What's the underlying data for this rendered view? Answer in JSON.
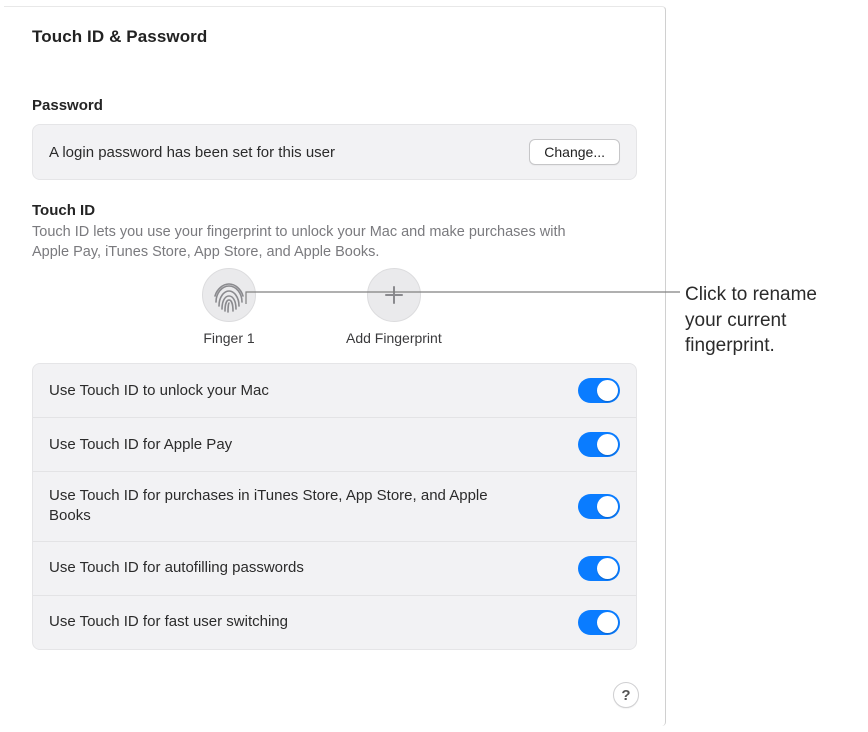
{
  "page_title": "Touch ID & Password",
  "password": {
    "heading": "Password",
    "status": "A login password has been set for this user",
    "change_label": "Change..."
  },
  "touchid": {
    "heading": "Touch ID",
    "description": "Touch ID lets you use your fingerprint to unlock your Mac and make purchases with Apple Pay, iTunes Store, App Store, and Apple Books.",
    "finger_label": "Finger 1",
    "add_label": "Add Fingerprint"
  },
  "options": [
    {
      "label": "Use Touch ID to unlock your Mac",
      "on": true
    },
    {
      "label": "Use Touch ID for Apple Pay",
      "on": true
    },
    {
      "label": "Use Touch ID for purchases in iTunes Store, App Store, and Apple Books",
      "on": true
    },
    {
      "label": "Use Touch ID for autofilling passwords",
      "on": true
    },
    {
      "label": "Use Touch ID for fast user switching",
      "on": true
    }
  ],
  "help_symbol": "?",
  "callout": "Click to rename your current fingerprint.",
  "colors": {
    "toggle_on": "#0a7cff",
    "card_bg": "#f2f2f4"
  }
}
